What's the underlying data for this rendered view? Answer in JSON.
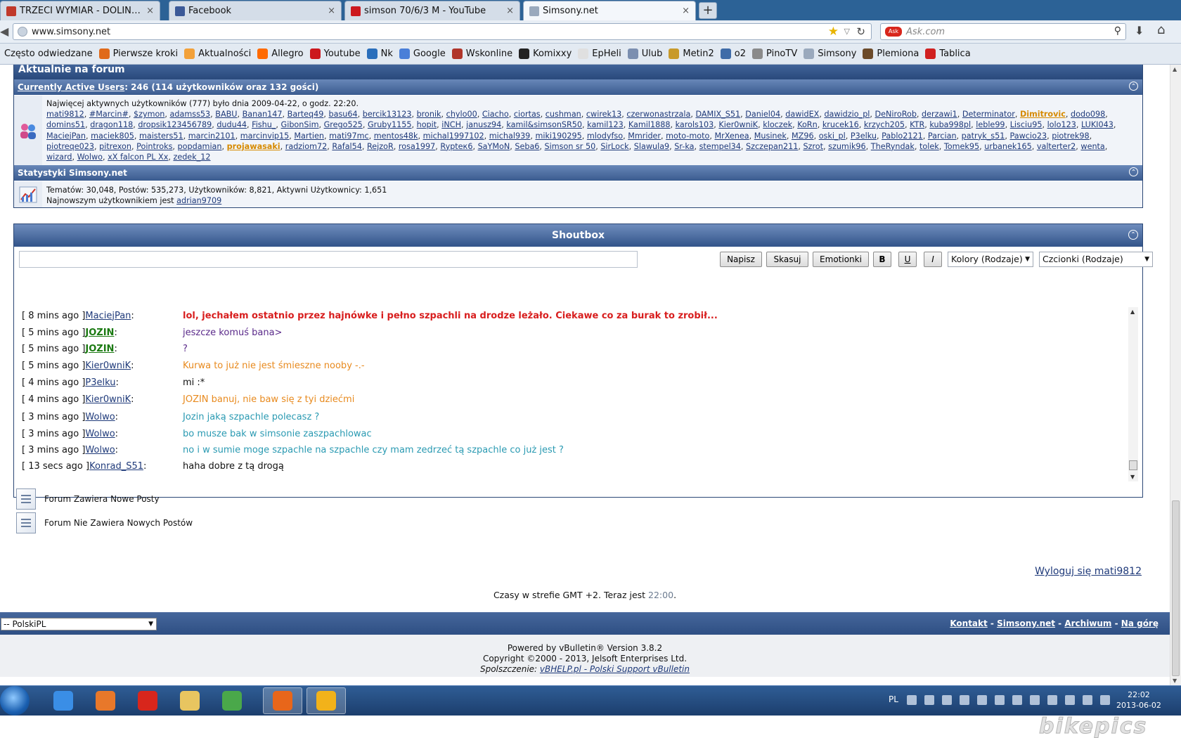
{
  "browser": {
    "tabs": [
      {
        "title": "TRZECI WYMIAR - DOLINA KLAUNO...",
        "favicon_color": "#c0392b"
      },
      {
        "title": "Facebook",
        "favicon_color": "#3b5998"
      },
      {
        "title": "simson 70/6/3 M - YouTube",
        "favicon_color": "#cc181e"
      },
      {
        "title": "Simsony.net",
        "favicon_color": "#9aa9bd"
      }
    ],
    "tab_close": "×",
    "new_tab": "+",
    "url": "www.simsony.net",
    "search_placeholder": "Ask.com",
    "search_logo": "Ask",
    "bookmarks": [
      {
        "label": "Często odwiedzane",
        "color": ""
      },
      {
        "label": "Pierwsze kroki",
        "color": "#e06a1a"
      },
      {
        "label": "Aktualności",
        "color": "#f2a13a"
      },
      {
        "label": "Allegro",
        "color": "#ff6a00"
      },
      {
        "label": "Youtube",
        "color": "#cc181e"
      },
      {
        "label": "Nk",
        "color": "#2a6ebb"
      },
      {
        "label": "Google",
        "color": "#4a7fd8"
      },
      {
        "label": "Wskonline",
        "color": "#b0352a"
      },
      {
        "label": "Komixxy",
        "color": "#222222"
      },
      {
        "label": "EpHeli",
        "color": "#e0e0e0"
      },
      {
        "label": "Ulub",
        "color": "#7b8fb0"
      },
      {
        "label": "Metin2",
        "color": "#c89a2a"
      },
      {
        "label": "o2",
        "color": "#3f6ca8"
      },
      {
        "label": "PinoTV",
        "color": "#8a8a8a"
      },
      {
        "label": "Simsony",
        "color": "#9aa9bd"
      },
      {
        "label": "Plemiona",
        "color": "#6b4a2a"
      },
      {
        "label": "Tablica",
        "color": "#d02020"
      }
    ]
  },
  "forum": {
    "whoson_title": "Aktualnie na forum",
    "active_users_link": "Currently Active Users",
    "active_users_count": ": 246 (114 użytkowników oraz 132 gości)",
    "record_text": "Najwięcej aktywnych użytkowników (777) było dnia 2009-04-22, o godz. 22:20.",
    "users": [
      "mati9812",
      "#Marcin#",
      "$zymon",
      "adamss53",
      "BABU",
      "Banan147",
      "Barteq49",
      "basu64",
      "bercik13123",
      "bronik",
      "chylo00",
      "Ciacho",
      "ciortas",
      "cushman",
      "cwirek13",
      "czerwonastrzala",
      "DAMIX_S51",
      "Daniel04",
      "dawidEX",
      "dawidzio_pl",
      "DeNiroRob",
      "derzawi1",
      "Determinator",
      "Dimitrovic",
      "dodo098",
      "domins51",
      "dragon118",
      "dropsik123456789",
      "dudu44",
      "Fishu_",
      "GibonSim",
      "Grego525",
      "Gruby1155",
      "hopit",
      "iNCH",
      "janusz94",
      "kamil&simsonSR50",
      "kamil123",
      "Kamil1888",
      "karols103",
      "Kier0wniK",
      "kloczek",
      "KoRn",
      "krucek16",
      "krzych205",
      "KTR",
      "kuba998pl",
      "leble99",
      "Lisciu95",
      "lolo123",
      "LUKI043",
      "MaciejPan",
      "maciek805",
      "maisters51",
      "marcin2101",
      "marcinvip15",
      "Martien",
      "mati97mc",
      "mentos48k",
      "michal1997102",
      "michal939",
      "miki190295",
      "mlodyfso",
      "Mmrider",
      "moto-moto",
      "MrXenea",
      "Musinek",
      "MZ96",
      "oski_pl",
      "P3elku",
      "Pablo2121",
      "Parcian",
      "patryk_s51",
      "Pawcio23",
      "piotrek98",
      "piotreqe023",
      "pitrexon",
      "Pointroks",
      "popdamian",
      "projawasaki",
      "radziom72",
      "Rafal54",
      "RejzoR",
      "rosa1997",
      "Rypteк6",
      "SaYMoN",
      "Seba6",
      "Simson sr 50",
      "SirLock",
      "Slawula9",
      "Sr-ka",
      "stempel34",
      "Szczepan211",
      "Szrot",
      "szumik96",
      "TheRyndak",
      "tolek",
      "Tomek95",
      "urbanek165",
      "valterter2",
      "wenta",
      "wizard",
      "Wolwo",
      "xX falcon PL Xx",
      "zedek_12"
    ],
    "highlighted_users": [
      "Dimitrovic",
      "projawasaki"
    ],
    "user_separator": ", ",
    "stats_title": "Statystyki Simsony.net",
    "stats_line": "Tematów: 30,048, Postów: 535,273, Użytkowników: 8,821, Aktywni Użytkownicy: 1,651",
    "newest_prefix": "Najnowszym użytkownikiem jest ",
    "newest_user": "adrian9709"
  },
  "shoutbox": {
    "title": "Shoutbox",
    "input_value": "",
    "buttons": {
      "write": "Napisz",
      "delete": "Skasuj",
      "emoticons": "Emotionki",
      "bold": "B",
      "underline": "U",
      "italic": "I"
    },
    "colors_select": "Kolory (Rodzaje)",
    "fonts_select": "Czcionki (Rodzaje)",
    "messages": [
      {
        "time": "[ 8 mins ago ]",
        "user": "MaciejPan",
        "user_style": "normal",
        "text": "lol, jechałem ostatnio przez hajnówke i pełno szpachli na drodze leżało. Ciekawe co za burak to zrobił...",
        "color": "#d81e1e",
        "bold": true,
        "font": "sans"
      },
      {
        "time": "[ 5 mins ago ]",
        "user": "JOZIN",
        "user_style": "green",
        "text": "jeszcze komuś bana>",
        "color": "#5a2a8a",
        "bold": false,
        "font": "sans"
      },
      {
        "time": "[ 5 mins ago ]",
        "user": "JOZIN",
        "user_style": "green",
        "text": "?",
        "color": "#5a2a8a",
        "bold": false,
        "font": "sans"
      },
      {
        "time": "[ 5 mins ago ]",
        "user": "Kier0wniK",
        "user_style": "normal",
        "text": "Kurwa to już nie jest śmieszne nooby -.-",
        "color": "#e88a1e",
        "bold": false,
        "font": "sans"
      },
      {
        "time": "[ 4 mins ago ]",
        "user": "P3elku",
        "user_style": "normal",
        "text": "mi :*",
        "color": "#111111",
        "bold": false,
        "font": "sans"
      },
      {
        "time": "[ 4 mins ago ]",
        "user": "Kier0wniK",
        "user_style": "normal",
        "text": "JOZIN banuj, nie baw się z tyi dziećmi",
        "color": "#e88a1e",
        "bold": false,
        "font": "sans"
      },
      {
        "time": "[ 3 mins ago ]",
        "user": "Wolwo",
        "user_style": "normal",
        "text": "Jozin jaką szpachle polecasz ?",
        "color": "#2a9ab2",
        "bold": false,
        "font": "sans"
      },
      {
        "time": "[ 3 mins ago ]",
        "user": "Wolwo",
        "user_style": "normal",
        "text": "bo musze bak w simsonie zaszpachlowac",
        "color": "#2a9ab2",
        "bold": false,
        "font": "sans"
      },
      {
        "time": "[ 3 mins ago ]",
        "user": "Wolwo",
        "user_style": "normal",
        "text": "no i w sumie moge szpachle na szpachle czy mam zedrzeć tą szpachle co już jest ?",
        "color": "#2a9ab2",
        "bold": false,
        "font": "sans"
      },
      {
        "time": "[ 13 secs ago ]",
        "user": "Konrad_S51",
        "user_style": "normal",
        "text": "haha dobre z tą drogą",
        "color": "#111111",
        "bold": false,
        "font": "sans"
      }
    ]
  },
  "legend": {
    "new_posts": "Forum Zawiera Nowe Posty",
    "no_new_posts": "Forum Nie Zawiera Nowych Postów"
  },
  "logout": "Wyloguj się mati9812",
  "timezone": {
    "prefix": "Czasy w strefie GMT +2. Teraz jest ",
    "now": "22:00",
    "suffix": "."
  },
  "footer": {
    "language": "-- PolskiPL",
    "links": [
      "Kontakt",
      "Simsony.net",
      "Archiwum",
      "Na górę"
    ],
    "link_sep": " - ",
    "powered": "Powered by vBulletin® Version 3.8.2",
    "copyright": "Copyright ©2000 - 2013, Jelsoft Enterprises Ltd.",
    "sponsor_prefix": "Spolszczenie: ",
    "sponsor_link": "vBHELP.pl - Polski Support vBulletin"
  },
  "taskbar": {
    "apps": [
      {
        "name": "internet-explorer",
        "color": "#3a8ee6"
      },
      {
        "name": "media-player",
        "color": "#e8782a"
      },
      {
        "name": "app-red",
        "color": "#d8261c"
      },
      {
        "name": "file-explorer",
        "color": "#e8c560"
      },
      {
        "name": "chrome",
        "color": "#4aa84a"
      },
      {
        "name": "firefox",
        "color": "#e8661a"
      },
      {
        "name": "app-sun",
        "color": "#f2b21a"
      }
    ],
    "lang": "PL",
    "time": "22:02",
    "date": "2013-06-02"
  },
  "watermark": "bikepics"
}
